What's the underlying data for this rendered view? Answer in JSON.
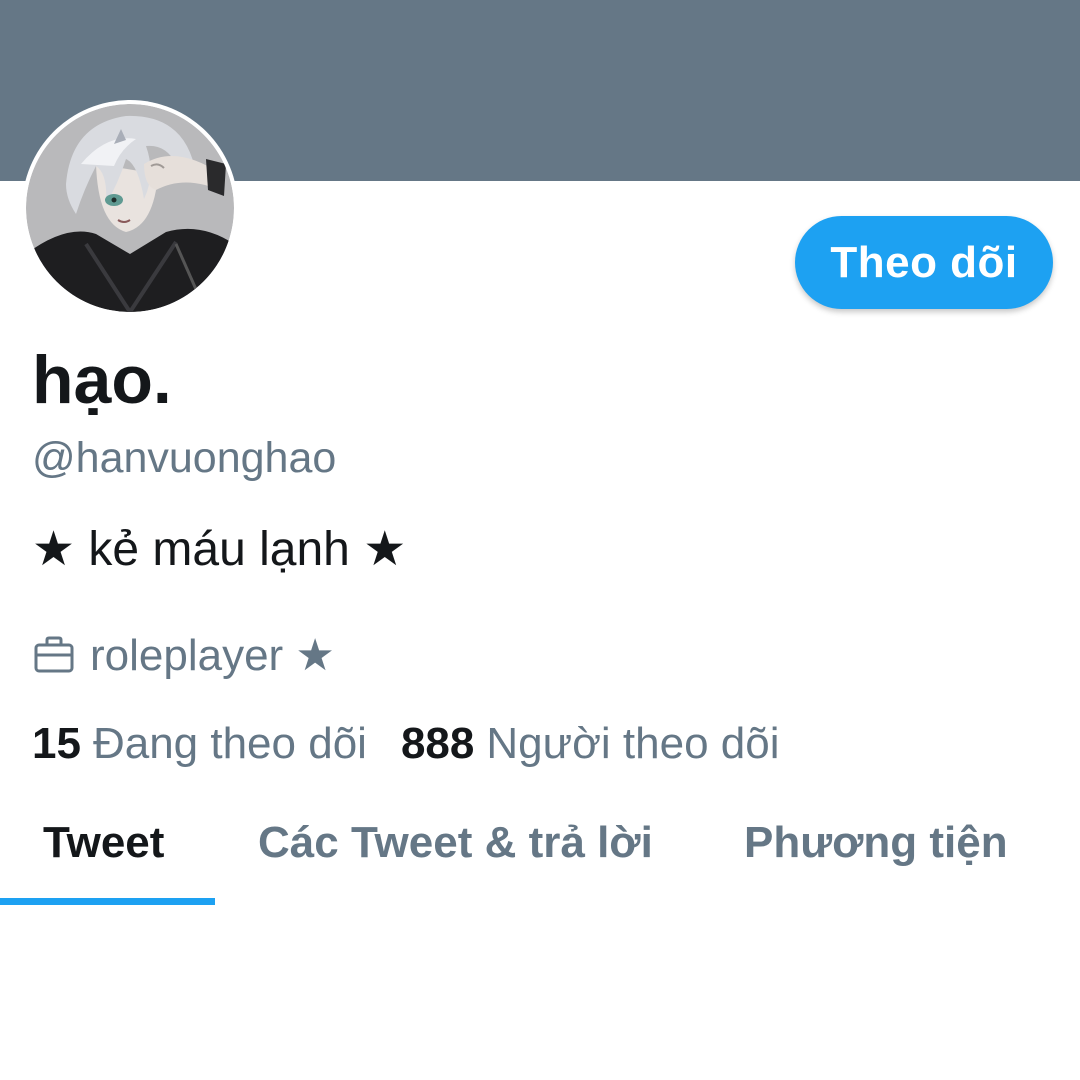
{
  "profile": {
    "banner_color": "#657786",
    "avatar_icon": "anime-character-avatar",
    "display_name": "hạo.",
    "handle": "@hanvuonghao",
    "bio": "★ kẻ máu lạnh ★",
    "profession_icon": "briefcase-icon",
    "profession": "roleplayer ★"
  },
  "actions": {
    "follow_label": "Theo dõi",
    "accent_color": "#1da1f2"
  },
  "stats": {
    "following_count": "15",
    "following_label": "Đang theo dõi",
    "followers_count": "888",
    "followers_label": "Người theo dõi"
  },
  "tabs": [
    {
      "label": "Tweet",
      "active": true
    },
    {
      "label": "Các Tweet & trả lời",
      "active": false
    },
    {
      "label": "Phương tiện",
      "active": false
    }
  ]
}
